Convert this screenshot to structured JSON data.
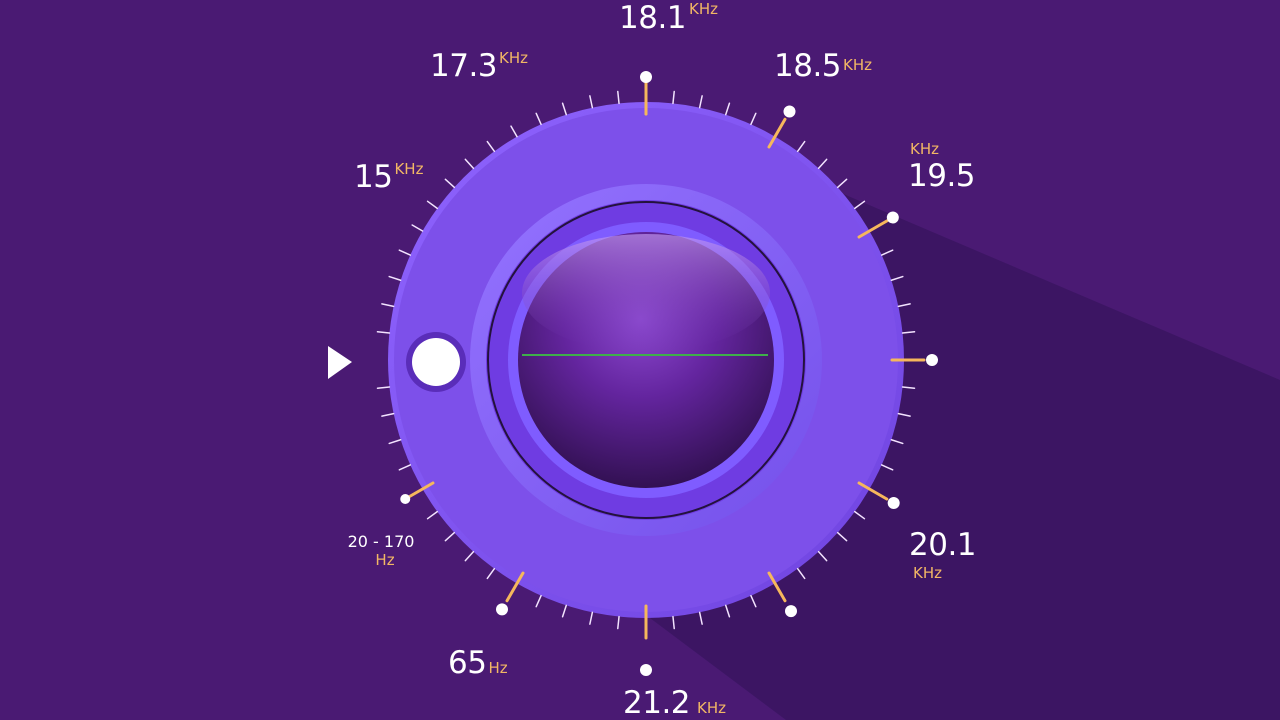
{
  "colors": {
    "background": "#4a1a73",
    "shadow": "#3a1560",
    "knob_outer": "#7f52ea",
    "knob_ring": "#8c6af4",
    "knob_inner": "#6f3ce2",
    "tick_minor": "#f3e3ff",
    "tick_major": "#f6b75c",
    "pointer": "#ffffff",
    "center_line": "#3fae4b"
  },
  "dial": {
    "pointer_icon": "triangle-right-icon",
    "handle_icon": "circle-handle-icon",
    "labels": [
      {
        "id": "label-18-1",
        "value": "18.1",
        "unit": "KHz"
      },
      {
        "id": "label-17-3",
        "value": "17.3",
        "unit": "KHz"
      },
      {
        "id": "label-18-5",
        "value": "18.5",
        "unit": "KHz"
      },
      {
        "id": "label-15",
        "value": "15",
        "unit": "KHz"
      },
      {
        "id": "label-19-5",
        "value": "19.5",
        "unit": "KHz"
      },
      {
        "id": "label-20-170",
        "value": "20 - 170",
        "unit": "Hz"
      },
      {
        "id": "label-20-1",
        "value": "20.1",
        "unit": "KHz"
      },
      {
        "id": "label-65",
        "value": "65",
        "unit": "Hz"
      },
      {
        "id": "label-21-2",
        "value": "21.2",
        "unit": "KHz"
      }
    ]
  }
}
